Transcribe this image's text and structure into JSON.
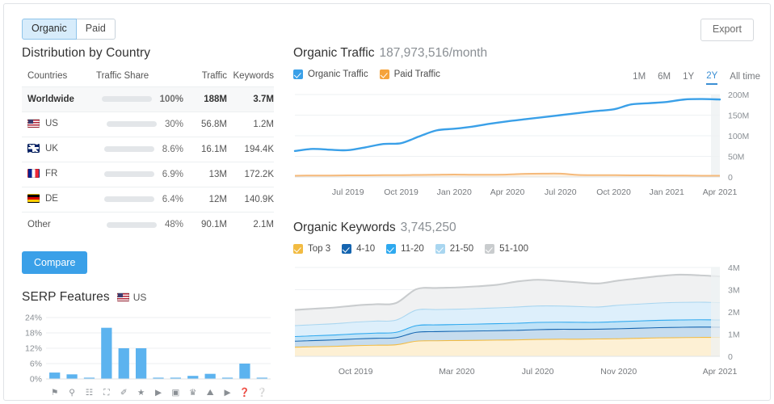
{
  "tabs": [
    {
      "label": "Organic",
      "active": true
    },
    {
      "label": "Paid",
      "active": false
    }
  ],
  "export_label": "Export",
  "distribution": {
    "title": "Distribution by Country",
    "columns": [
      "Countries",
      "Traffic Share",
      "Traffic",
      "Keywords"
    ],
    "rows": [
      {
        "country": "Worldwide",
        "flag": "none",
        "share_pct": 100,
        "share_label": "100%",
        "traffic": "188M",
        "keywords": "3.7M",
        "highlight": true,
        "link": false
      },
      {
        "country": "US",
        "flag": "us",
        "share_pct": 30,
        "share_label": "30%",
        "traffic": "56.8M",
        "keywords": "1.2M",
        "highlight": false,
        "link": true
      },
      {
        "country": "UK",
        "flag": "uk",
        "share_pct": 8.6,
        "share_label": "8.6%",
        "traffic": "16.1M",
        "keywords": "194.4K",
        "highlight": false,
        "link": true
      },
      {
        "country": "FR",
        "flag": "fr",
        "share_pct": 6.9,
        "share_label": "6.9%",
        "traffic": "13M",
        "keywords": "172.2K",
        "highlight": false,
        "link": true
      },
      {
        "country": "DE",
        "flag": "de",
        "share_pct": 6.4,
        "share_label": "6.4%",
        "traffic": "12M",
        "keywords": "140.9K",
        "highlight": false,
        "link": true
      },
      {
        "country": "Other",
        "flag": "none",
        "share_pct": 48,
        "share_label": "48%",
        "traffic": "90.1M",
        "keywords": "2.1M",
        "highlight": false,
        "link": false
      }
    ],
    "compare_label": "Compare"
  },
  "serp": {
    "title": "SERP Features",
    "country_label": "US",
    "country_flag": "us"
  },
  "organic_traffic": {
    "title": "Organic Traffic",
    "value": "187,973,516/month",
    "legend": [
      {
        "label": "Organic Traffic",
        "color": "#3aa0e8",
        "checked": true
      },
      {
        "label": "Paid Traffic",
        "color": "#f5a33c",
        "checked": true
      }
    ],
    "ranges": [
      {
        "label": "1M",
        "active": false
      },
      {
        "label": "6M",
        "active": false
      },
      {
        "label": "1Y",
        "active": false
      },
      {
        "label": "2Y",
        "active": true
      },
      {
        "label": "All time",
        "active": false
      }
    ]
  },
  "organic_keywords": {
    "title": "Organic Keywords",
    "value": "3,745,250",
    "legend": [
      {
        "label": "Top 3",
        "color": "#f2bb42",
        "checked": true
      },
      {
        "label": "4-10",
        "color": "#1565b0",
        "checked": true
      },
      {
        "label": "11-20",
        "color": "#2ea9ef",
        "checked": true
      },
      {
        "label": "21-50",
        "color": "#a9d6f0",
        "checked": true
      },
      {
        "label": "51-100",
        "color": "#c9ccce",
        "checked": true
      }
    ]
  },
  "chart_data": [
    {
      "type": "bar",
      "name": "serp-features",
      "title": "SERP Features",
      "xlabel": "",
      "ylabel": "",
      "ylim": [
        0,
        24
      ],
      "yticks": [
        "0%",
        "6%",
        "12%",
        "18%",
        "24%"
      ],
      "grid": true,
      "categories": [
        "featured-snippet",
        "local-pack",
        "site-links",
        "image-pack",
        "related-links",
        "reviews",
        "video",
        "video-carousel",
        "top-stories",
        "image",
        "instant-answer",
        "faq",
        "knowledge-panel"
      ],
      "values": [
        2.5,
        1.8,
        0.5,
        20.0,
        12.0,
        12.0,
        0.5,
        0.5,
        1.2,
        2.0,
        0.5,
        6.0,
        0.5
      ],
      "color": "#5cb3ef"
    },
    {
      "type": "line",
      "name": "organic-traffic",
      "title": "Organic Traffic",
      "xlabel": "",
      "ylabel": "",
      "ylim": [
        0,
        200000000
      ],
      "yticks": [
        "0",
        "50M",
        "100M",
        "150M",
        "200M"
      ],
      "xticks": [
        "Jul 2019",
        "Oct 2019",
        "Jan 2020",
        "Apr 2020",
        "Jul 2020",
        "Oct 2020",
        "Jan 2021",
        "Apr 2021"
      ],
      "grid": true,
      "x": [
        "Apr 2019",
        "May 2019",
        "Jun 2019",
        "Jul 2019",
        "Aug 2019",
        "Sep 2019",
        "Oct 2019",
        "Nov 2019",
        "Dec 2019",
        "Jan 2020",
        "Feb 2020",
        "Mar 2020",
        "Apr 2020",
        "May 2020",
        "Jun 2020",
        "Jul 2020",
        "Aug 2020",
        "Sep 2020",
        "Oct 2020",
        "Nov 2020",
        "Dec 2020",
        "Jan 2021",
        "Feb 2021",
        "Mar 2021",
        "Apr 2021"
      ],
      "series": [
        {
          "name": "Organic Traffic",
          "color": "#3aa0e8",
          "values": [
            63000000,
            68000000,
            66000000,
            65000000,
            72000000,
            80000000,
            82000000,
            98000000,
            113000000,
            117000000,
            122000000,
            129000000,
            135000000,
            140000000,
            145000000,
            150000000,
            155000000,
            160000000,
            164000000,
            176000000,
            179000000,
            182000000,
            188000000,
            189000000,
            188000000
          ]
        },
        {
          "name": "Paid Traffic",
          "color": "#f5b97a",
          "values": [
            3000000,
            3500000,
            3500000,
            4000000,
            4000000,
            4500000,
            4500000,
            5000000,
            5500000,
            6000000,
            5500000,
            5500000,
            6000000,
            7500000,
            8000000,
            8000000,
            5000000,
            4500000,
            4500000,
            4000000,
            4000000,
            3500000,
            3500000,
            3000000,
            3000000
          ]
        }
      ]
    },
    {
      "type": "area",
      "name": "organic-keywords",
      "title": "Organic Keywords",
      "xlabel": "",
      "ylabel": "",
      "ylim": [
        0,
        4000000
      ],
      "yticks": [
        "0",
        "1M",
        "2M",
        "3M",
        "4M"
      ],
      "xticks": [
        "Oct 2019",
        "Mar 2020",
        "Jul 2020",
        "Nov 2020",
        "Apr 2021"
      ],
      "grid": true,
      "stacked": true,
      "x": [
        "Jul 2019",
        "Aug 2019",
        "Sep 2019",
        "Oct 2019",
        "Nov 2019",
        "Dec 2019",
        "Jan 2020",
        "Feb 2020",
        "Mar 2020",
        "Apr 2020",
        "May 2020",
        "Jun 2020",
        "Jul 2020",
        "Aug 2020",
        "Sep 2020",
        "Oct 2020",
        "Nov 2020",
        "Dec 2020",
        "Jan 2021",
        "Feb 2021",
        "Mar 2021",
        "Apr 2021"
      ],
      "series": [
        {
          "name": "Top 3",
          "color": "#f2bb42",
          "fill": "#fdf0d4",
          "values": [
            430000,
            450000,
            470000,
            500000,
            520000,
            540000,
            700000,
            720000,
            730000,
            740000,
            750000,
            760000,
            780000,
            790000,
            790000,
            800000,
            810000,
            830000,
            850000,
            860000,
            870000,
            870000
          ]
        },
        {
          "name": "4-10",
          "color": "#1565b0",
          "fill": "#c6dcee",
          "values": [
            270000,
            280000,
            290000,
            300000,
            310000,
            320000,
            400000,
            410000,
            415000,
            420000,
            425000,
            430000,
            440000,
            445000,
            445000,
            440000,
            450000,
            455000,
            460000,
            465000,
            465000,
            460000
          ]
        },
        {
          "name": "11-20",
          "color": "#2ea9ef",
          "fill": "#bfe2f7",
          "values": [
            210000,
            215000,
            220000,
            230000,
            235000,
            240000,
            300000,
            305000,
            305000,
            310000,
            315000,
            320000,
            325000,
            320000,
            315000,
            310000,
            320000,
            325000,
            330000,
            330000,
            330000,
            325000
          ]
        },
        {
          "name": "21-50",
          "color": "#a9d6f0",
          "fill": "#ddeffb",
          "values": [
            490000,
            500000,
            510000,
            530000,
            540000,
            550000,
            700000,
            690000,
            690000,
            700000,
            710000,
            730000,
            740000,
            730000,
            710000,
            690000,
            740000,
            760000,
            780000,
            790000,
            790000,
            780000
          ]
        },
        {
          "name": "51-100",
          "color": "#c9ccce",
          "fill": "#f0f1f2",
          "values": [
            690000,
            700000,
            710000,
            730000,
            740000,
            750000,
            920000,
            950000,
            960000,
            980000,
            1020000,
            1130000,
            1160000,
            1110000,
            1070000,
            1040000,
            1090000,
            1140000,
            1190000,
            1230000,
            1190000,
            1160000
          ]
        }
      ]
    }
  ]
}
